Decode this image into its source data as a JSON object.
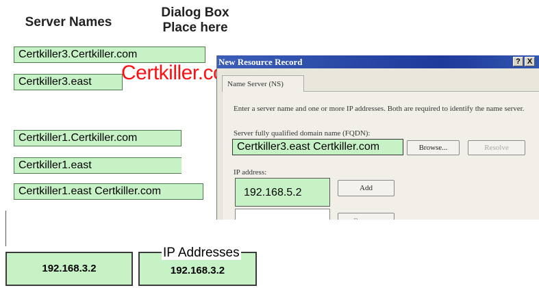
{
  "headings": {
    "server_names": "Server Names",
    "dialog_box_line1": "Dialog Box",
    "dialog_box_line2": "Place here",
    "ip_addresses": "IP Addresses"
  },
  "watermark": "Certkiller.com",
  "server_names": [
    "Certkiller3.Certkiller.com",
    "Certkiller3.east",
    "Certkiller1.Certkiller.com",
    "Certkiller1.east",
    "Certkiller1.east Certkiller.com"
  ],
  "ip_addresses": [
    "192.168.3.2",
    "192.168.3.2"
  ],
  "dialog": {
    "title": "New Resource Record",
    "help_btn": "?",
    "close_btn": "X",
    "tab_label": "Name Server (NS)",
    "instructions": "Enter a server name and one or more IP addresses. Both are required to identify the name server.",
    "fqdn_label": "Server fully qualified domain name (FQDN):",
    "fqdn_value": "Certkiller3.east Certkiller.com",
    "browse_btn": "Browse...",
    "resolve_btn": "Resolve",
    "ip_label": "IP address:",
    "ip_value": "192.168.5.2",
    "add_btn": "Add",
    "remove_btn": "Remove"
  },
  "colors": {
    "box_fill": "#c6f2c6",
    "watermark": "#ff1010",
    "titlebar": "#1e3a9a"
  }
}
